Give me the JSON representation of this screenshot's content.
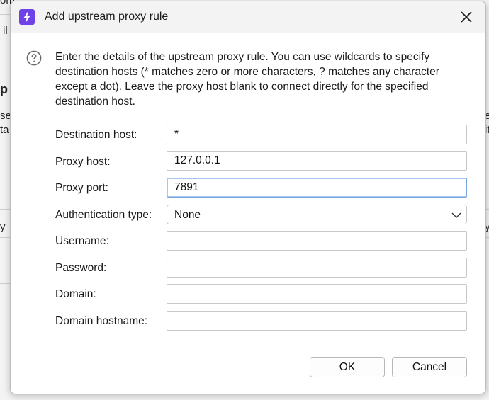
{
  "background": {
    "fragments": [
      "om",
      "il",
      "p",
      "se",
      "ta",
      "e",
      "it",
      "y",
      "ty"
    ]
  },
  "dialog": {
    "title": "Add upstream proxy rule",
    "app_icon": "lightning-bolt-icon",
    "close_icon": "close-icon",
    "info_icon": "question-circle-icon",
    "description": "Enter the details of the upstream proxy rule. You can use wildcards to specify destination hosts (* matches zero or more characters, ? matches any character except a dot). Leave the proxy host blank to connect directly for the specified destination host.",
    "fields": {
      "destination_host": {
        "label": "Destination host:",
        "value": "*"
      },
      "proxy_host": {
        "label": "Proxy host:",
        "value": "127.0.0.1"
      },
      "proxy_port": {
        "label": "Proxy port:",
        "value": "7891"
      },
      "auth_type": {
        "label": "Authentication type:",
        "value": "None"
      },
      "username": {
        "label": "Username:",
        "value": ""
      },
      "password": {
        "label": "Password:",
        "value": ""
      },
      "domain": {
        "label": "Domain:",
        "value": ""
      },
      "domain_hostname": {
        "label": "Domain hostname:",
        "value": ""
      }
    },
    "buttons": {
      "ok": "OK",
      "cancel": "Cancel"
    },
    "colors": {
      "accent": "#6f42e8",
      "focus_border": "#7aa7e0"
    }
  }
}
